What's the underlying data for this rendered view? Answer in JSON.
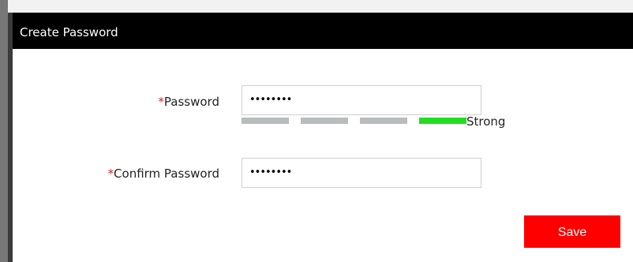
{
  "dialog": {
    "title": "Create Password"
  },
  "form": {
    "required_marker": "*",
    "password_label": "Password",
    "password_value": "••••••••",
    "confirm_label": "Confirm Password",
    "confirm_value": "••••••••"
  },
  "strength": {
    "label": "Strong",
    "level": 4,
    "max_level": 4,
    "colors": {
      "active": "#22dd22",
      "inactive": "#b8bcbc"
    }
  },
  "actions": {
    "save_label": "Save"
  },
  "colors": {
    "title_bar": "#000000",
    "required": "#e51c1c",
    "save_button": "#ff0000"
  }
}
